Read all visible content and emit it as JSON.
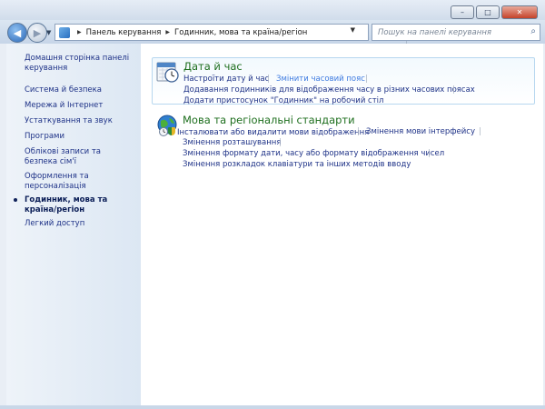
{
  "window": {
    "controls": {
      "minimize": "–",
      "maximize": "□",
      "close": "✕"
    }
  },
  "navbar": {
    "back_icon": "◀",
    "forward_icon": "▶",
    "dropdown_icon": "▼",
    "breadcrumb": [
      "Панель керування",
      "Годинник, мова та країна/регіон"
    ],
    "separator": "▶",
    "refresh_icon": "⇆",
    "search_placeholder": "Пошук на панелі керування",
    "search_icon": "⌕"
  },
  "sidebar": {
    "items": [
      "Домашня сторінка панелі керування",
      "Система й безпека",
      "Мережа й Інтернет",
      "Устаткування та звук",
      "Програми",
      "Облікові записи та безпека сім'ї",
      "Оформлення та персоналізація",
      "Годинник, мова та країна/регіон",
      "Легкий доступ"
    ],
    "active_index": 7
  },
  "categories": [
    {
      "title": "Дата й час",
      "icon": "clock-icon",
      "rows": [
        [
          "Настроїти дату й час",
          "Змінити часовий пояс"
        ],
        [
          "Додавання годинників для відображення часу в різних часових поясах"
        ],
        [
          "Додати пристосунок \"Годинник\" на робочий стіл"
        ]
      ]
    },
    {
      "title": "Мова та регіональні стандарти",
      "icon": "globe-icon",
      "rows": [
        [
          "Інсталювати або видалити мови відображення",
          "Змінення мови інтерфейсу"
        ],
        [
          "Змінення розташування"
        ],
        [
          "Змінення формату дати, часу або формату відображення чисел"
        ],
        [
          "Змінення розкладок клавіатури та інших методів вводу"
        ]
      ]
    }
  ],
  "colors": {
    "link": "#1e3287",
    "category_title": "#1d6e1d",
    "hovered_link": "#3e7be0",
    "sidebar_bg": "#dce7f3"
  }
}
